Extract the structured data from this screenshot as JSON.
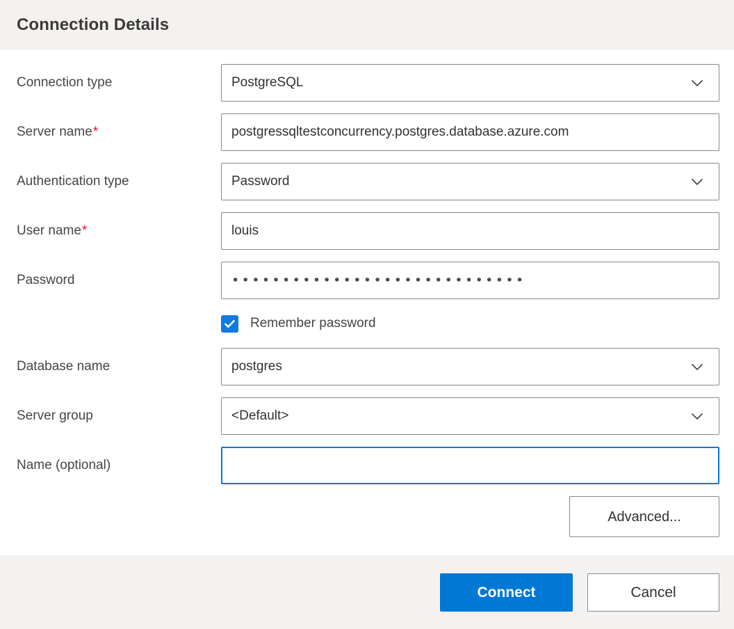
{
  "header": {
    "title": "Connection Details"
  },
  "form": {
    "rows": [
      {
        "label": "Connection type",
        "required": false,
        "kind": "dropdown",
        "value": "PostgreSQL",
        "name": "connection-type"
      },
      {
        "label": "Server name",
        "required": true,
        "kind": "text",
        "value": "postgressqltestconcurrency.postgres.database.azure.com",
        "name": "server-name"
      },
      {
        "label": "Authentication type",
        "required": false,
        "kind": "dropdown",
        "value": "Password",
        "name": "authentication-type"
      },
      {
        "label": "User name",
        "required": true,
        "kind": "text",
        "value": "louis",
        "name": "user-name"
      },
      {
        "label": "Password",
        "required": false,
        "kind": "password",
        "value": "•••••••••••••••••••••••••••••",
        "name": "password"
      }
    ],
    "remember_password": {
      "label": "Remember password",
      "checked": true
    },
    "rows2": [
      {
        "label": "Database name",
        "required": false,
        "kind": "dropdown",
        "value": "postgres",
        "name": "database-name"
      },
      {
        "label": "Server group",
        "required": false,
        "kind": "dropdown",
        "value": "<Default>",
        "name": "server-group"
      },
      {
        "label": "Name (optional)",
        "required": false,
        "kind": "text-focused",
        "value": "",
        "name": "connection-name"
      }
    ],
    "advanced_label": "Advanced..."
  },
  "footer": {
    "connect_label": "Connect",
    "cancel_label": "Cancel"
  },
  "colors": {
    "accent": "#0078d4",
    "checkbox": "#0f7ae5",
    "required": "#e81123",
    "header_bg": "#f3f2f1",
    "border": "#8a8886"
  },
  "icons": {
    "chevron": "chevron-down-icon",
    "check": "checkmark-icon"
  }
}
